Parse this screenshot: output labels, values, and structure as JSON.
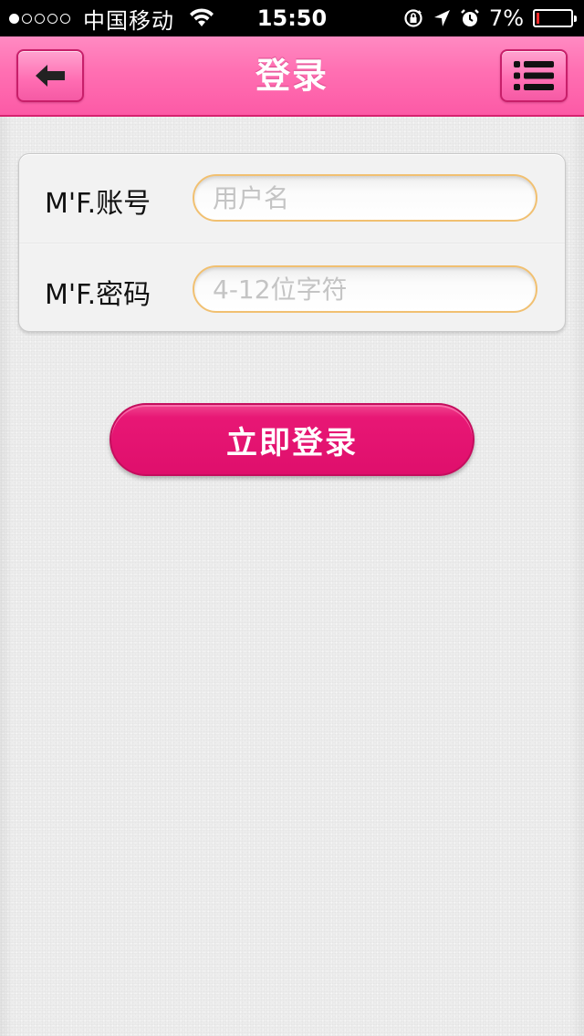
{
  "status_bar": {
    "carrier": "中国移动",
    "time": "15:50",
    "battery_percent": "7%",
    "battery_level": 0.07
  },
  "header": {
    "title": "登录",
    "back_icon": "arrow-left-icon",
    "menu_icon": "list-icon"
  },
  "form": {
    "account_label": "M'F.账号",
    "account_placeholder": "用户名",
    "account_value": "",
    "password_label": "M'F.密码",
    "password_placeholder": "4-12位字符",
    "password_value": ""
  },
  "login_button": {
    "label": "立即登录"
  },
  "colors": {
    "header_pink": "#ff6fb2",
    "button_magenta": "#df0f6c",
    "field_border": "#f1c071"
  }
}
